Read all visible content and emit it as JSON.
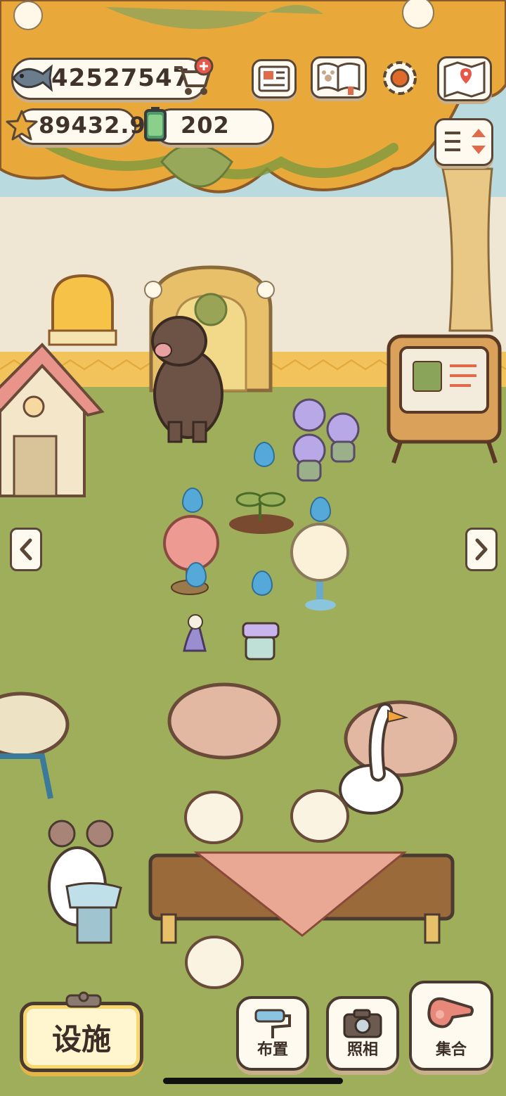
{
  "hud": {
    "fish_currency": "42527547",
    "star_currency": "89432.9",
    "battery_count": "202"
  },
  "icons": {
    "fish": "fish-icon",
    "shop_cart": "shop-cart-add-icon",
    "star": "star-icon",
    "battery": "battery-icon",
    "newspaper": "newspaper-icon",
    "pawbook": "paw-book-icon",
    "settings": "gear-icon",
    "map": "map-icon",
    "sort": "sort-icon"
  },
  "bottom_bar": {
    "facilities_label": "设施",
    "arrange_label": "布置",
    "photo_label": "照相",
    "gather_label": "集合"
  },
  "colors": {
    "grass": "#9fae5a",
    "wall": "#efe6d4",
    "roof": "#e9a93a",
    "outline": "#4a3a30",
    "water": "#55a9d8"
  }
}
